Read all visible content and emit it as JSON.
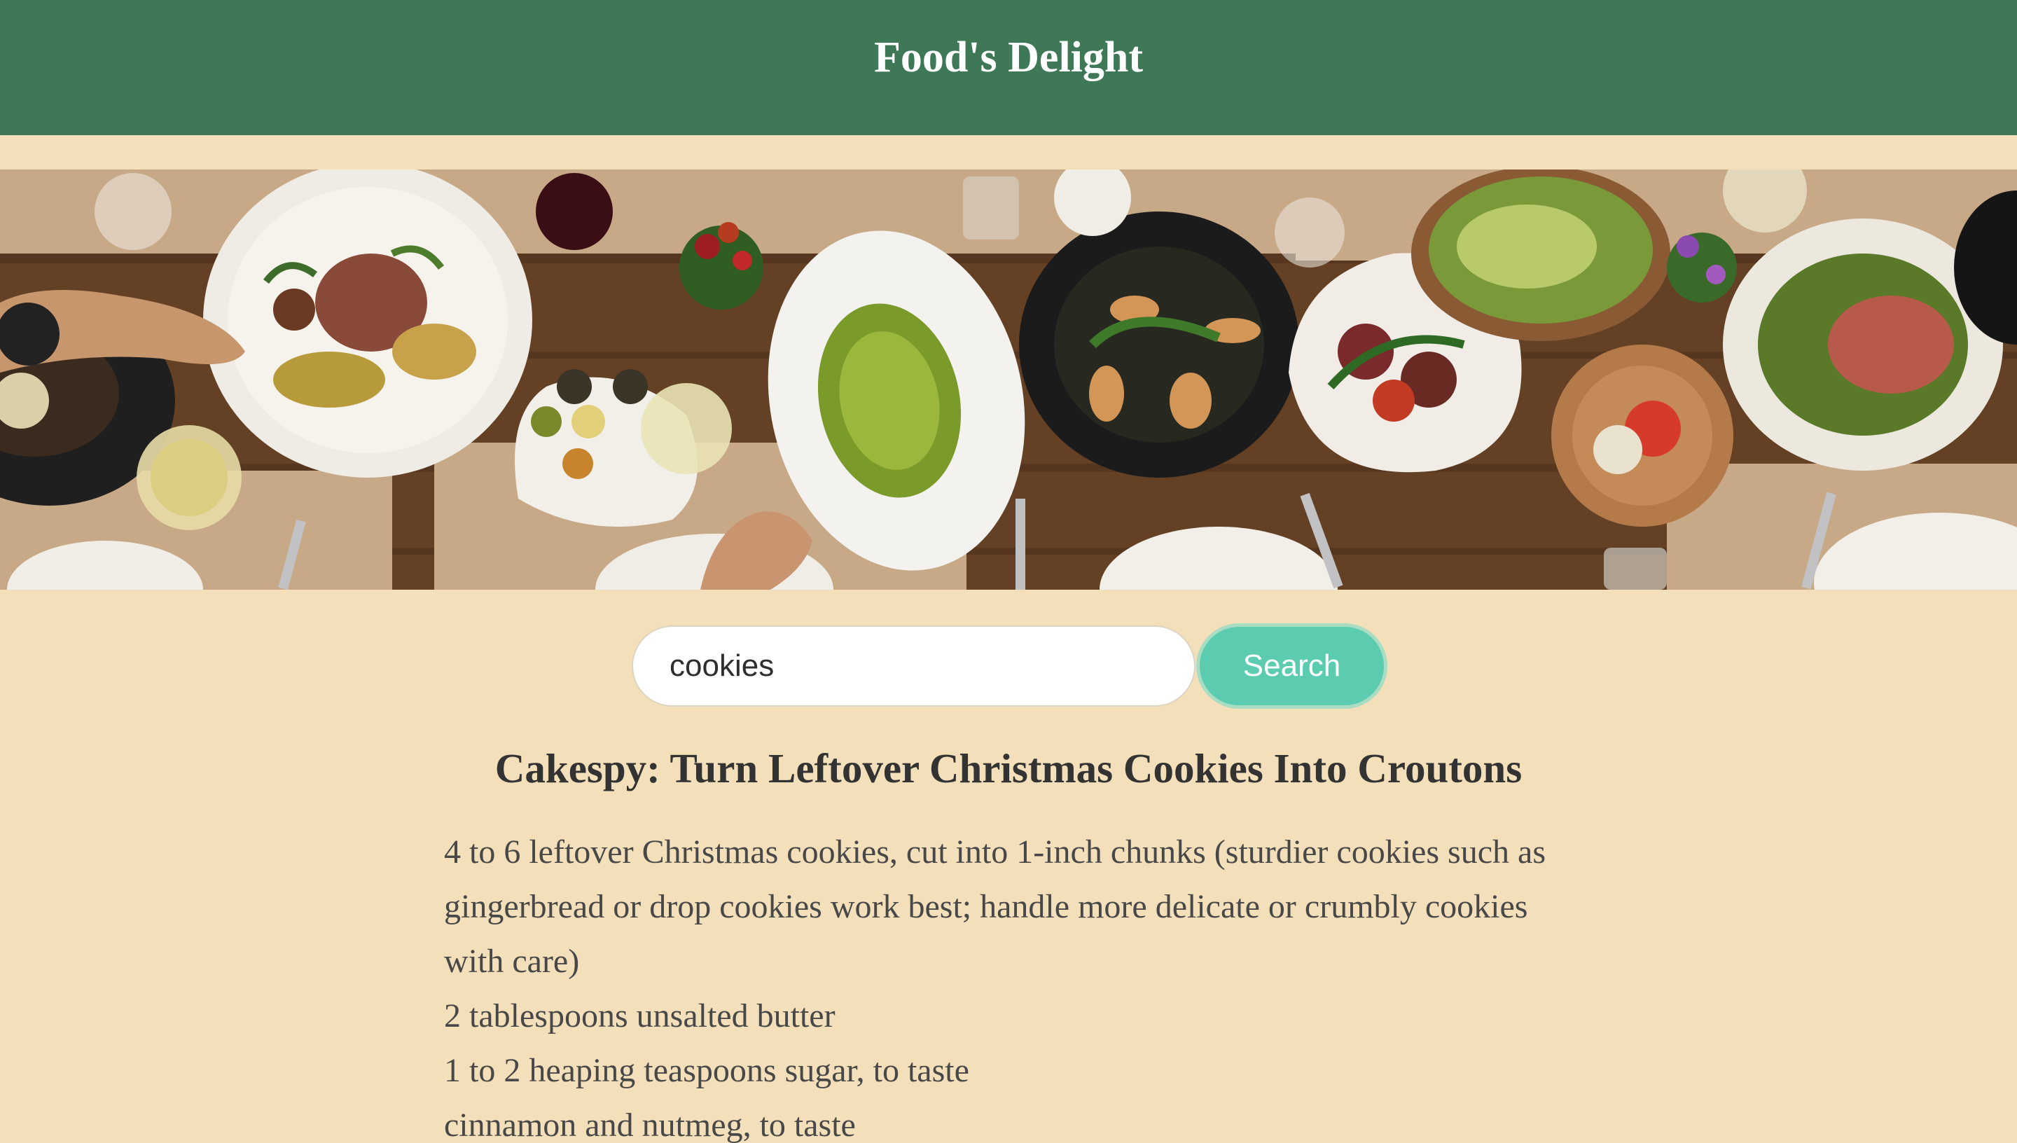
{
  "header": {
    "title": "Food's Delight"
  },
  "hero": {
    "image_description": "overhead-food-table-banner-image"
  },
  "search": {
    "value": "cookies",
    "button_label": "Search"
  },
  "recipe": {
    "title": "Cakespy: Turn Leftover Christmas Cookies Into Croutons",
    "ingredients": [
      "4 to 6 leftover Christmas cookies, cut into 1-inch chunks (sturdier cookies such as gingerbread or drop cookies work best; handle more delicate or crumbly cookies with care)",
      "2 tablespoons unsalted butter",
      "1 to 2 heaping teaspoons sugar, to taste",
      "cinnamon and nutmeg, to taste"
    ]
  },
  "colors": {
    "header_bg": "#3e7856",
    "page_bg": "#f3dfb9",
    "button_bg": "#5bccb0"
  }
}
